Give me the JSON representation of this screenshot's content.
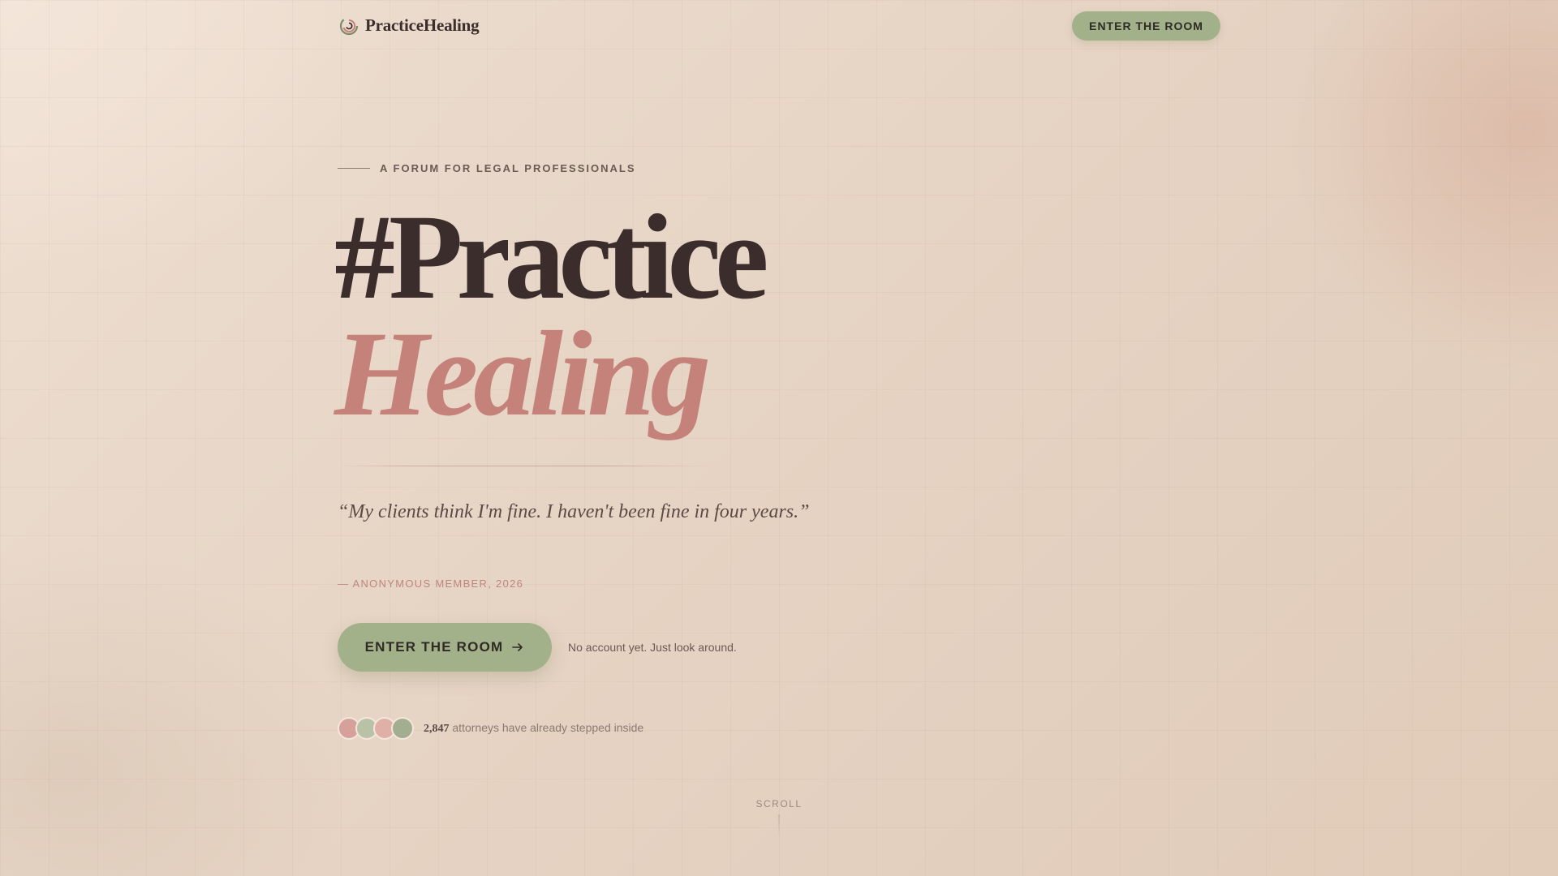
{
  "header": {
    "brand": "PracticeHealing",
    "cta_label": "ENTER THE ROOM"
  },
  "hero": {
    "eyebrow": "A FORUM FOR LEGAL PROFESSIONALS",
    "title_line1": "#Practice",
    "title_line2": "Healing",
    "quote": "“My clients think I'm fine. I haven't been fine in four years.”",
    "attribution": "— ANONYMOUS MEMBER, 2026",
    "cta_label": "ENTER THE ROOM",
    "cta_note": "No account yet. Just look around."
  },
  "social_proof": {
    "count": "2,847",
    "text": "attorneys have already stepped inside",
    "avatar_colors": [
      "#d5a19a",
      "#b9c2a6",
      "#e0afa5",
      "#a3ad8f"
    ]
  },
  "scroll": {
    "label": "SCROLL"
  },
  "colors": {
    "accent_green": "#a3b18b",
    "accent_rose": "#c5827a",
    "text_dark": "#3a2d2c"
  }
}
